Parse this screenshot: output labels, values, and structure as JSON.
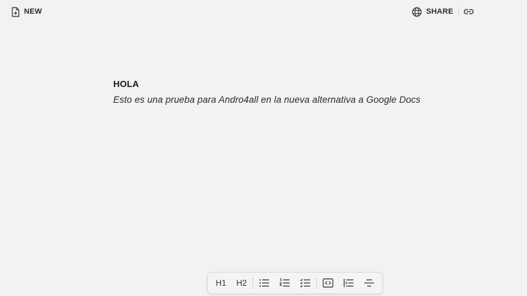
{
  "topbar": {
    "new_label": "NEW",
    "new_icon": "new-document-icon",
    "share_label": "SHARE",
    "share_icon": "globe-icon",
    "link_icon": "link-icon"
  },
  "document": {
    "heading": "HOLA",
    "paragraph": "Esto es una prueba para Andro4all en la nueva alternativa a Google Docs"
  },
  "toolbar": {
    "h1_label": "H1",
    "h2_label": "H2",
    "icons": [
      "bullet-list-icon",
      "numbered-list-icon",
      "checklist-icon",
      "code-block-icon",
      "indent-icon",
      "strikethrough-icon"
    ]
  },
  "colors": {
    "background": "#f2f2f2",
    "text": "#1f1f1f",
    "toolbar_border": "#dcdcdc"
  }
}
